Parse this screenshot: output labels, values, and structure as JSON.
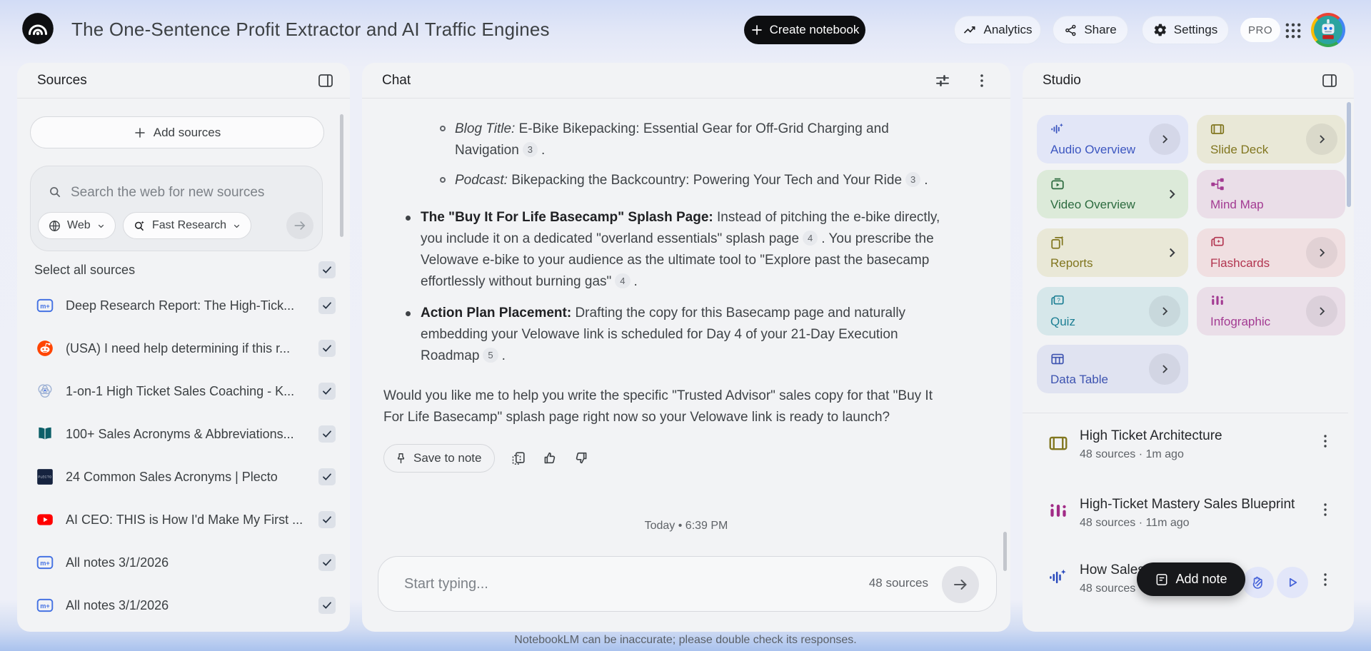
{
  "header": {
    "title": "The One-Sentence Profit Extractor and AI Traffic Engines",
    "create_notebook": "Create notebook",
    "analytics": "Analytics",
    "share": "Share",
    "settings": "Settings",
    "pro_badge": "PRO"
  },
  "colors": {
    "primary_button_bg": "#0d0e10",
    "accent_blue": "#4663d9",
    "youtube_red": "#ff0000",
    "reddit_orange": "#ff4500"
  },
  "sources": {
    "title": "Sources",
    "add_button": "Add sources",
    "search_placeholder": "Search the web for new sources",
    "web_dropdown": "Web",
    "research_dropdown": "Fast Research",
    "select_all": "Select all sources",
    "items": [
      {
        "icon": "notes-doc",
        "title": "Deep Research Report: The High-Tick...",
        "checked": true
      },
      {
        "icon": "reddit",
        "title": "(USA) I need help determining if this r...",
        "checked": true
      },
      {
        "icon": "venn-circles",
        "title": "1-on-1 High Ticket Sales Coaching - K...",
        "checked": true
      },
      {
        "icon": "book",
        "title": "100+ Sales Acronyms & Abbreviations...",
        "checked": true
      },
      {
        "icon": "plecto",
        "title": "24 Common Sales Acronyms | Plecto",
        "checked": true
      },
      {
        "icon": "youtube",
        "title": "AI CEO: THIS is How I'd Make My First ...",
        "checked": true
      },
      {
        "icon": "notes-doc",
        "title": "All notes 3/1/2026",
        "checked": true
      },
      {
        "icon": "notes-doc",
        "title": "All notes 3/1/2026",
        "checked": true
      }
    ]
  },
  "chat": {
    "title": "Chat",
    "sub_bullets": [
      {
        "lead": "Blog Title:",
        "text": " E-Bike Bikepacking: Essential Gear for Off-Grid Charging and Navigation",
        "citation": "3",
        "end": "."
      },
      {
        "lead": "Podcast:",
        "text": " Bikepacking the Backcountry: Powering Your Tech and Your Ride",
        "citation": "3",
        "end": "."
      }
    ],
    "bullets": [
      {
        "lead": "The \"Buy It For Life Basecamp\" Splash Page:",
        "seg1": " Instead of pitching the e-bike directly, you include it on a dedicated \"overland essentials\" splash page",
        "cit1": "4",
        "seg2": ". You prescribe the Velowave e-bike to your audience as the ultimate tool to \"Explore past the basecamp effortlessly without burning gas\"",
        "cit2": "4",
        "end": "."
      },
      {
        "lead": "Action Plan Placement:",
        "seg1": " Drafting the copy for this Basecamp page and naturally embedding your Velowave link is scheduled for Day 4 of your 21-Day Execution Roadmap",
        "cit1": "5",
        "end": "."
      }
    ],
    "closing": "Would you like me to help you write the specific \"Trusted Advisor\" sales copy for that \"Buy It For Life Basecamp\" splash page right now so your Velowave link is ready to launch?",
    "save_to_note": "Save to note",
    "timestamp": "Today • 6:39 PM",
    "input_placeholder": "Start typing...",
    "source_count": "48 sources",
    "disclaimer": "NotebookLM can be inaccurate; please double check its responses."
  },
  "studio": {
    "title": "Studio",
    "tiles": [
      {
        "label": "Audio Overview",
        "bg": "#e2e6f7",
        "fg": "#3c56c0"
      },
      {
        "label": "Slide Deck",
        "bg": "#e9e8d7",
        "fg": "#81761f"
      },
      {
        "label": "Video Overview",
        "bg": "#dcead9",
        "fg": "#2c6b3f"
      },
      {
        "label": "Mind Map",
        "bg": "#eadee8",
        "fg": "#a33b92"
      },
      {
        "label": "Reports",
        "bg": "#e9e8d7",
        "fg": "#81761f"
      },
      {
        "label": "Flashcards",
        "bg": "#f0dfe1",
        "fg": "#b23550"
      },
      {
        "label": "Quiz",
        "bg": "#d6e7ea",
        "fg": "#1d7f94"
      },
      {
        "label": "Infographic",
        "bg": "#eadee8",
        "fg": "#a33b92"
      },
      {
        "label": "Data Table",
        "bg": "#e0e3f1",
        "fg": "#3d53b0"
      }
    ],
    "items": [
      {
        "title": "High Ticket Architecture",
        "meta": "48 sources · 1m ago"
      },
      {
        "title": "High-Ticket Mastery Sales Blueprint",
        "meta": "48 sources · 11m ago"
      },
      {
        "title": "How Sales",
        "meta": "48 sources"
      }
    ],
    "add_note": "Add note"
  }
}
